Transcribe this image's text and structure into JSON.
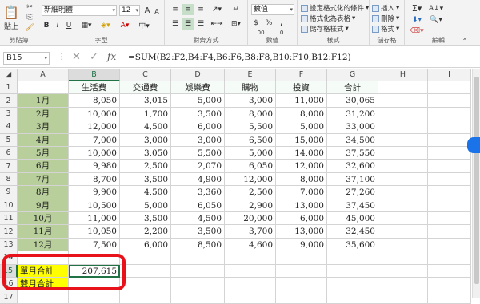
{
  "ribbon": {
    "clipboard": {
      "paste_label": "貼上",
      "group_label": "剪貼簿"
    },
    "font": {
      "font_name": "新細明體",
      "font_size": "12",
      "bold": "B",
      "italic": "I",
      "underline": "U",
      "font_color_glyph": "A",
      "grow": "A",
      "shrink": "A",
      "group_label": "字型"
    },
    "alignment": {
      "group_label": "對齊方式"
    },
    "number": {
      "format": "數值",
      "currency": "$",
      "percent": "%",
      "comma": ",",
      "inc_dec": ".00",
      "dec_dec": ".0",
      "group_label": "數值"
    },
    "styles": {
      "conditional": "設定格式化的條件",
      "format_table": "格式化為表格",
      "cell_styles": "儲存格樣式",
      "group_label": "樣式"
    },
    "cells": {
      "insert": "插入",
      "delete": "刪除",
      "format": "格式",
      "group_label": "儲存格"
    },
    "editing": {
      "group_label": "編輯"
    }
  },
  "formula_bar": {
    "name_box": "B15",
    "fx": "fx",
    "formula": "=SUM(B2:F2,B4:F4,B6:F6,B8:F8,B10:F10,B12:F12)"
  },
  "sheet": {
    "columns": [
      "A",
      "B",
      "C",
      "D",
      "E",
      "F",
      "G",
      "H",
      "I"
    ],
    "rows": [
      "1",
      "2",
      "3",
      "4",
      "5",
      "6",
      "7",
      "8",
      "9",
      "10",
      "11",
      "12",
      "13",
      "14",
      "15",
      "16",
      "17"
    ],
    "headers": [
      "生活費",
      "交通費",
      "娛樂費",
      "購物",
      "投資",
      "合計"
    ],
    "data": [
      {
        "month": "1月",
        "values": [
          "8,050",
          "3,015",
          "5,000",
          "3,000",
          "11,000",
          "30,065"
        ]
      },
      {
        "month": "2月",
        "values": [
          "10,000",
          "1,700",
          "3,500",
          "8,000",
          "8,000",
          "31,200"
        ]
      },
      {
        "month": "3月",
        "values": [
          "12,000",
          "4,500",
          "6,000",
          "5,500",
          "5,000",
          "33,000"
        ]
      },
      {
        "month": "4月",
        "values": [
          "7,000",
          "3,000",
          "3,000",
          "6,500",
          "15,000",
          "34,500"
        ]
      },
      {
        "month": "5月",
        "values": [
          "10,000",
          "3,050",
          "5,500",
          "5,000",
          "14,000",
          "37,550"
        ]
      },
      {
        "month": "6月",
        "values": [
          "9,980",
          "2,500",
          "2,070",
          "6,050",
          "12,000",
          "32,600"
        ]
      },
      {
        "month": "7月",
        "values": [
          "8,700",
          "3,500",
          "4,900",
          "12,000",
          "8,000",
          "37,100"
        ]
      },
      {
        "month": "8月",
        "values": [
          "9,900",
          "4,500",
          "3,360",
          "2,500",
          "7,000",
          "27,260"
        ]
      },
      {
        "month": "9月",
        "values": [
          "10,500",
          "5,000",
          "6,050",
          "2,900",
          "13,000",
          "37,450"
        ]
      },
      {
        "month": "10月",
        "values": [
          "11,000",
          "3,500",
          "4,500",
          "20,000",
          "6,000",
          "45,000"
        ]
      },
      {
        "month": "11月",
        "values": [
          "10,050",
          "2,200",
          "3,500",
          "3,700",
          "13,000",
          "32,450"
        ]
      },
      {
        "month": "12月",
        "values": [
          "7,500",
          "6,000",
          "8,500",
          "4,600",
          "9,000",
          "35,600"
        ]
      }
    ],
    "summary": [
      {
        "label": "單月合計",
        "value": "207,615"
      },
      {
        "label": "雙月合計",
        "value": ""
      }
    ]
  }
}
